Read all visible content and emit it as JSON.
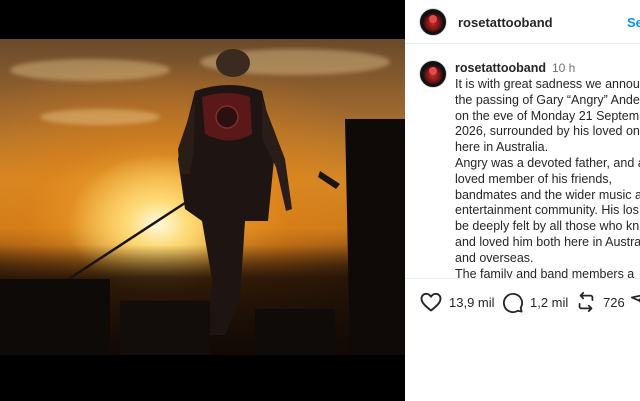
{
  "post": {
    "username": "rosetattooband",
    "follow_label": "Se",
    "caption": {
      "username": "rosetattooband",
      "time": "10 h",
      "text": "It is with great sadness we announ the passing of Gary “Angry” Ande on the eve of Monday 21 Septem 2026, surrounded by his loved on here in Australia.\nAngry was a devoted father, and a loved member of his friends, bandmates and the wider music a entertainment community. His los be deeply felt by all those who kn and loved him both here in Austra and overseas.\nThe family and band members a"
    },
    "actions": {
      "likes": "13,9 mil",
      "comments": "1,2 mil",
      "reposts": "726"
    }
  },
  "icons": [
    "heart-icon",
    "comment-icon",
    "repost-icon",
    "share-icon"
  ],
  "colors": {
    "link": "#0095f6",
    "text": "#262626",
    "muted": "#737373"
  }
}
